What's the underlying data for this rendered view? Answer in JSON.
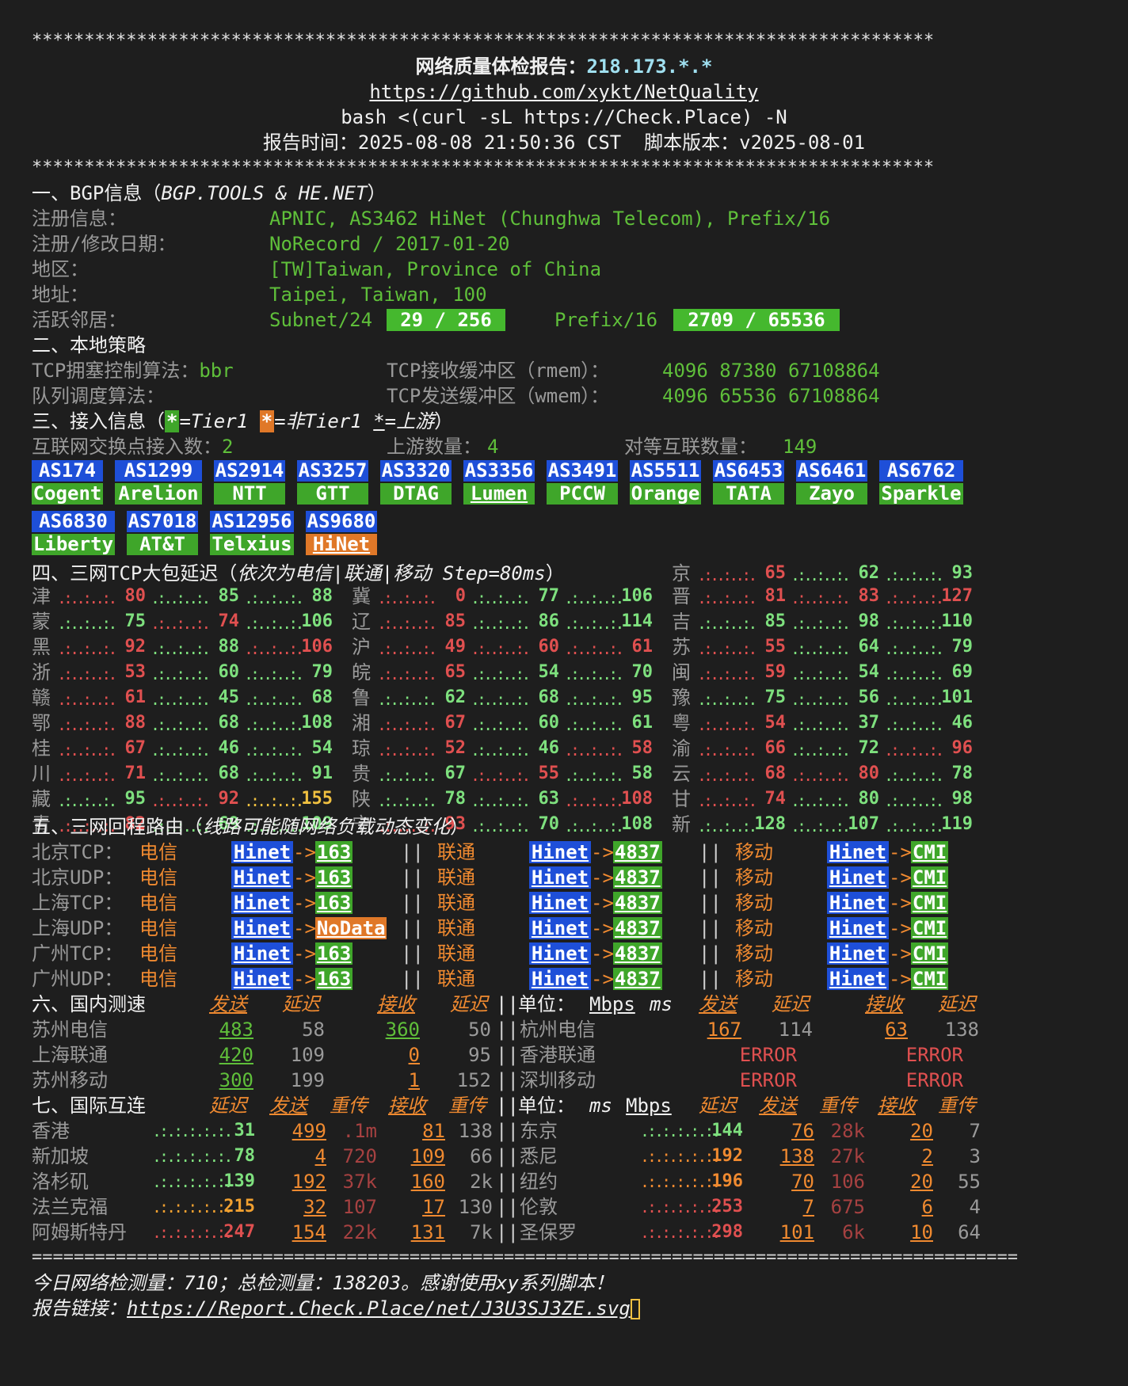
{
  "header": {
    "stars": "**************************************************************************************",
    "title": "网络质量体检报告：",
    "ip": "218.173.*.*",
    "repo": "https://github.com/xykt/NetQuality",
    "command": "bash <(curl -sL https://Check.Place) -N",
    "time_label": "报告时间：",
    "time_value": "2025-08-08 21:50:36 CST",
    "version_label": "脚本版本：",
    "version_value": "v2025-08-01"
  },
  "bgp": {
    "section": "一、BGP信息（",
    "section_src": "BGP.TOOLS & HE.NET",
    "section_end": "）",
    "reg_label": "注册信息：",
    "reg_value": "APNIC, AS3462 HiNet (Chunghwa Telecom), Prefix/16",
    "date_label": "注册/修改日期：",
    "date_value": "NoRecord / 2017-01-20",
    "region_label": "地区：",
    "region_value": "[TW]Taiwan, Province of China",
    "addr_label": "地址：",
    "addr_value": "Taipei, Taiwan, 100",
    "neighbor_label": "活跃邻居：",
    "subnet_label": "Subnet/24",
    "subnet_value": "29 / 256",
    "prefix_label": "Prefix/16",
    "prefix_value": "2709 / 65536"
  },
  "policy": {
    "section": "二、本地策略",
    "cc_label": "TCP拥塞控制算法：",
    "cc_value": "bbr",
    "rmem_label": "TCP接收缓冲区（rmem）：",
    "rmem_value": "4096 87380 67108864",
    "qdisc_label": "队列调度算法：",
    "wmem_label": "TCP发送缓冲区（wmem）：",
    "wmem_value": "4096 65536 67108864"
  },
  "access": {
    "section": "三、接入信息（",
    "legend_star": "*",
    "legend_tier1": "=Tier1 ",
    "legend_nontier1": "=非Tier1 ",
    "legend_upstream_star": "*",
    "legend_upstream": "=上游",
    "legend_end": "）",
    "ix_label": "互联网交换点接入数：",
    "ix_value": "2",
    "upstream_label": "上游数量：",
    "upstream_value": "4",
    "peer_label": "对等互联数量：",
    "peer_value": "149",
    "as_row1": [
      {
        "as": "AS174",
        "name": "Cogent",
        "type": "green"
      },
      {
        "as": "AS1299",
        "name": "Arelion",
        "type": "green"
      },
      {
        "as": "AS2914",
        "name": "NTT",
        "type": "green"
      },
      {
        "as": "AS3257",
        "name": "GTT",
        "type": "green"
      },
      {
        "as": "AS3320",
        "name": "DTAG",
        "type": "green"
      },
      {
        "as": "AS3356",
        "name": "Lumen",
        "type": "green",
        "upstream": true
      },
      {
        "as": "AS3491",
        "name": "PCCW",
        "type": "green"
      },
      {
        "as": "AS5511",
        "name": "Orange",
        "type": "green"
      },
      {
        "as": "AS6453",
        "name": "TATA",
        "type": "green"
      },
      {
        "as": "AS6461",
        "name": "Zayo",
        "type": "green"
      },
      {
        "as": "AS6762",
        "name": "Sparkle",
        "type": "green"
      }
    ],
    "as_row2": [
      {
        "as": "AS6830",
        "name": "Liberty",
        "type": "green"
      },
      {
        "as": "AS7018",
        "name": "AT&T",
        "type": "green"
      },
      {
        "as": "AS12956",
        "name": "Telxius",
        "type": "green"
      },
      {
        "as": "AS9680",
        "name": "HiNet",
        "type": "orange",
        "upstream": true
      }
    ]
  },
  "latency": {
    "section": "四、三网TCP大包延迟（",
    "section_sub": "依次为电信|联通|移动 Step=80ms",
    "section_end": "）",
    "rows": [
      {
        "c1": {
          "p": "津",
          "v": [
            "80",
            "85",
            "88"
          ],
          "k": [
            "red",
            "green",
            "green"
          ]
        },
        "c2": {
          "p": "冀",
          "v": [
            "0",
            "77",
            "106"
          ],
          "k": [
            "red",
            "green",
            "green"
          ]
        },
        "c3": {
          "p": "晋",
          "v": [
            "81",
            "83",
            "127"
          ],
          "k": [
            "red",
            "red",
            "red"
          ]
        }
      },
      {
        "c1": {
          "p": "蒙",
          "v": [
            "75",
            "74",
            "106"
          ],
          "k": [
            "green",
            "red",
            "green"
          ]
        },
        "c2": {
          "p": "辽",
          "v": [
            "85",
            "86",
            "114"
          ],
          "k": [
            "red",
            "green",
            "green"
          ]
        },
        "c3": {
          "p": "吉",
          "v": [
            "85",
            "98",
            "110"
          ],
          "k": [
            "green",
            "green",
            "green"
          ]
        }
      },
      {
        "c1": {
          "p": "黑",
          "v": [
            "92",
            "88",
            "106"
          ],
          "k": [
            "red",
            "green",
            "red"
          ]
        },
        "c2": {
          "p": "沪",
          "v": [
            "49",
            "60",
            "61"
          ],
          "k": [
            "red",
            "red",
            "red"
          ]
        },
        "c3": {
          "p": "苏",
          "v": [
            "55",
            "64",
            "79"
          ],
          "k": [
            "red",
            "green",
            "green"
          ]
        }
      },
      {
        "c1": {
          "p": "浙",
          "v": [
            "53",
            "60",
            "79"
          ],
          "k": [
            "red",
            "green",
            "green"
          ]
        },
        "c2": {
          "p": "皖",
          "v": [
            "65",
            "54",
            "70"
          ],
          "k": [
            "red",
            "green",
            "green"
          ]
        },
        "c3": {
          "p": "闽",
          "v": [
            "59",
            "54",
            "69"
          ],
          "k": [
            "red",
            "green",
            "green"
          ]
        }
      },
      {
        "c1": {
          "p": "赣",
          "v": [
            "61",
            "45",
            "68"
          ],
          "k": [
            "red",
            "green",
            "green"
          ]
        },
        "c2": {
          "p": "鲁",
          "v": [
            "62",
            "68",
            "95"
          ],
          "k": [
            "green",
            "green",
            "green"
          ]
        },
        "c3": {
          "p": "豫",
          "v": [
            "75",
            "56",
            "101"
          ],
          "k": [
            "green",
            "green",
            "green"
          ]
        }
      },
      {
        "c1": {
          "p": "鄂",
          "v": [
            "88",
            "68",
            "108"
          ],
          "k": [
            "red",
            "green",
            "green"
          ]
        },
        "c2": {
          "p": "湘",
          "v": [
            "67",
            "60",
            "61"
          ],
          "k": [
            "red",
            "green",
            "green"
          ]
        },
        "c3": {
          "p": "粤",
          "v": [
            "54",
            "37",
            "46"
          ],
          "k": [
            "red",
            "green",
            "green"
          ]
        }
      },
      {
        "c1": {
          "p": "桂",
          "v": [
            "67",
            "46",
            "54"
          ],
          "k": [
            "red",
            "green",
            "green"
          ]
        },
        "c2": {
          "p": "琼",
          "v": [
            "52",
            "46",
            "58"
          ],
          "k": [
            "red",
            "green",
            "red"
          ]
        },
        "c3": {
          "p": "渝",
          "v": [
            "66",
            "72",
            "96"
          ],
          "k": [
            "red",
            "green",
            "red"
          ]
        }
      },
      {
        "c1": {
          "p": "川",
          "v": [
            "71",
            "68",
            "91"
          ],
          "k": [
            "red",
            "green",
            "green"
          ]
        },
        "c2": {
          "p": "贵",
          "v": [
            "67",
            "55",
            "58"
          ],
          "k": [
            "green",
            "red",
            "green"
          ]
        },
        "c3": {
          "p": "云",
          "v": [
            "68",
            "80",
            "78"
          ],
          "k": [
            "red",
            "red",
            "green"
          ]
        }
      },
      {
        "c1": {
          "p": "藏",
          "v": [
            "95",
            "92",
            "155"
          ],
          "k": [
            "green",
            "red",
            "yellow"
          ]
        },
        "c2": {
          "p": "陕",
          "v": [
            "78",
            "63",
            "108"
          ],
          "k": [
            "green",
            "green",
            "red"
          ]
        },
        "c3": {
          "p": "甘",
          "v": [
            "74",
            "80",
            "98"
          ],
          "k": [
            "red",
            "green",
            "green"
          ]
        }
      },
      {
        "c1": {
          "p": "青",
          "v": [
            "82",
            "69",
            "109"
          ],
          "k": [
            "red",
            "green",
            "green"
          ]
        },
        "c2": {
          "p": "宁",
          "v": [
            "93",
            "70",
            "108"
          ],
          "k": [
            "red",
            "green",
            "green"
          ]
        },
        "c3": {
          "p": "新",
          "v": [
            "128",
            "107",
            "119"
          ],
          "k": [
            "green",
            "green",
            "green"
          ]
        }
      }
    ],
    "top": {
      "p": "京",
      "v": [
        "65",
        "62",
        "93"
      ],
      "k": [
        "red",
        "green",
        "green"
      ]
    }
  },
  "route": {
    "section": "五、三网回程路由（",
    "section_sub": "线路可能随网络负载动态变化",
    "section_end": "）",
    "isp_ct": "电信",
    "isp_cu": "联通",
    "isp_cm": "移动",
    "arrow": "->",
    "bar": "||",
    "rows": [
      {
        "label": "北京TCP：",
        "ct": "163",
        "ct_kind": "green",
        "cu": "4837",
        "cm": "CMI",
        "src": "Hinet"
      },
      {
        "label": "北京UDP：",
        "ct": "163",
        "ct_kind": "green",
        "cu": "4837",
        "cm": "CMI",
        "src": "Hinet"
      },
      {
        "label": "上海TCP：",
        "ct": "163",
        "ct_kind": "green",
        "cu": "4837",
        "cm": "CMI",
        "src": "Hinet"
      },
      {
        "label": "上海UDP：",
        "ct": "NoData",
        "ct_kind": "orange",
        "cu": "4837",
        "cm": "CMI",
        "src": "Hinet"
      },
      {
        "label": "广州TCP：",
        "ct": "163",
        "ct_kind": "green",
        "cu": "4837",
        "cm": "CMI",
        "src": "Hinet"
      },
      {
        "label": "广州UDP：",
        "ct": "163",
        "ct_kind": "green",
        "cu": "4837",
        "cm": "CMI",
        "src": "Hinet"
      }
    ]
  },
  "domestic": {
    "section": "六、国内测速",
    "h_send": "发送",
    "h_lat": "延迟",
    "h_recv": "接收",
    "h_lat2": "延迟",
    "unit_label": "单位：",
    "unit_bw": "Mbps",
    "unit_ms": "ms",
    "rows": [
      {
        "l": {
          "name": "苏州电信",
          "send": "483",
          "lat": "58",
          "recv": "360",
          "lat2": "50"
        },
        "r": {
          "name": "杭州电信",
          "send": "167",
          "lat": "114",
          "recv": "63",
          "lat2": "138"
        }
      },
      {
        "l": {
          "name": "上海联通",
          "send": "420",
          "lat": "109",
          "recv": "0",
          "lat2": "95"
        },
        "r": {
          "name": "香港联通",
          "send": "",
          "lat": "ERROR",
          "recv": "",
          "lat2": "ERROR"
        }
      },
      {
        "l": {
          "name": "苏州移动",
          "send": "300",
          "lat": "199",
          "recv": "1",
          "lat2": "152"
        },
        "r": {
          "name": "深圳移动",
          "send": "",
          "lat": "ERROR",
          "recv": "",
          "lat2": "ERROR"
        }
      }
    ]
  },
  "intl": {
    "section": "七、国际互连",
    "h_lat": "延迟",
    "h_send": "发送",
    "h_retx": "重传",
    "h_recv": "接收",
    "h_retx2": "重传",
    "unit_label": "单位：",
    "unit_ms": "ms",
    "unit_bw": "Mbps",
    "rows": [
      {
        "l": {
          "name": "香港",
          "lat": "31",
          "send": "499",
          "retx": ".1m",
          "recv": "81",
          "retx2": "138"
        },
        "r": {
          "name": "东京",
          "lat": "144",
          "send": "76",
          "retx": "28k",
          "recv": "20",
          "retx2": "7"
        }
      },
      {
        "l": {
          "name": "新加坡",
          "lat": "78",
          "send": "4",
          "retx": "720",
          "recv": "109",
          "retx2": "66"
        },
        "r": {
          "name": "悉尼",
          "lat": "192",
          "send": "138",
          "retx": "27k",
          "recv": "2",
          "retx2": "3"
        }
      },
      {
        "l": {
          "name": "洛杉矶",
          "lat": "139",
          "send": "192",
          "retx": "37k",
          "recv": "160",
          "retx2": "2k"
        },
        "r": {
          "name": "纽约",
          "lat": "196",
          "send": "70",
          "retx": "106",
          "recv": "20",
          "retx2": "55"
        }
      },
      {
        "l": {
          "name": "法兰克福",
          "lat": "215",
          "send": "32",
          "retx": "107",
          "recv": "17",
          "retx2": "130"
        },
        "r": {
          "name": "伦敦",
          "lat": "253",
          "send": "7",
          "retx": "675",
          "recv": "6",
          "retx2": "4"
        }
      },
      {
        "l": {
          "name": "阿姆斯特丹",
          "lat": "247",
          "send": "154",
          "retx": "22k",
          "recv": "131",
          "retx2": "7k"
        },
        "r": {
          "name": "圣保罗",
          "lat": "298",
          "send": "101",
          "retx": "6k",
          "recv": "10",
          "retx2": "64"
        }
      }
    ]
  },
  "footer": {
    "rule": "==============================================================================================",
    "stats": "今日网络检测量：710；总检测量：138203。感谢使用xy系列脚本！",
    "link_label": "报告链接：",
    "link": "https://Report.Check.Place/net/J3U3SJ3ZE.svg"
  },
  "colors": {
    "bg": "#1e1e1e",
    "blue": "#1e4fd8",
    "green": "#3fa62a",
    "orange": "#e07828",
    "text_green": "#5fbf3a",
    "red": "#e05050"
  }
}
